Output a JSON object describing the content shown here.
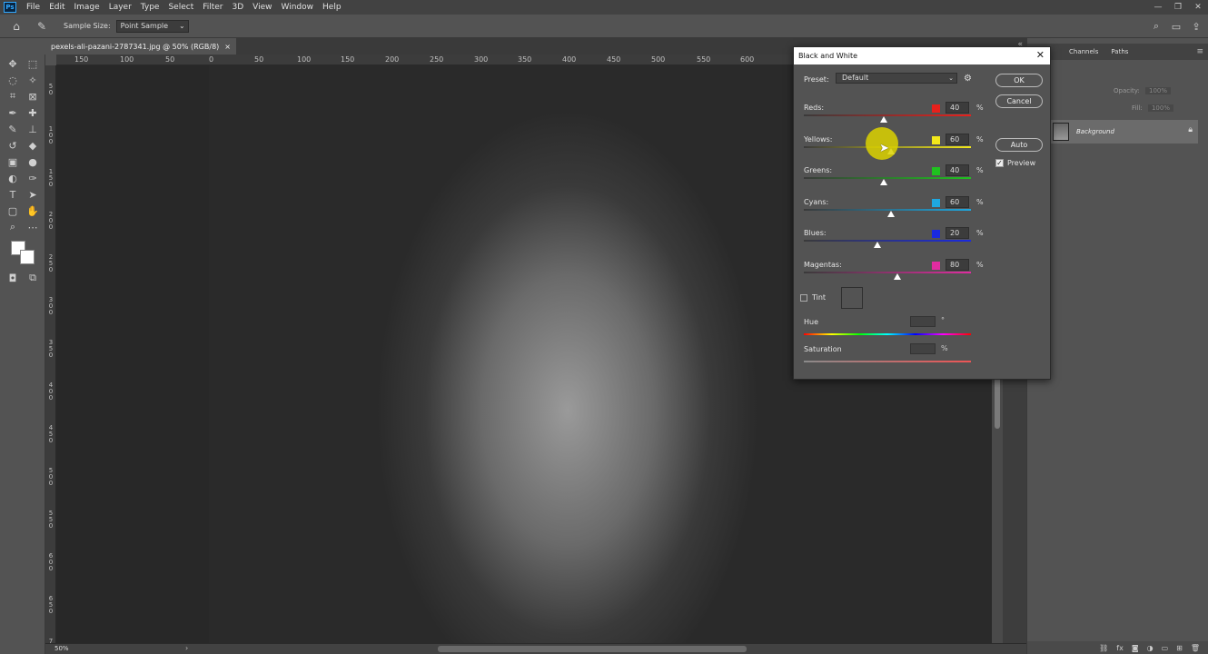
{
  "menubar": {
    "logo": "Ps",
    "items": [
      "File",
      "Edit",
      "Image",
      "Layer",
      "Type",
      "Select",
      "Filter",
      "3D",
      "View",
      "Window",
      "Help"
    ],
    "window_controls": [
      "—",
      "❐",
      "✕"
    ]
  },
  "options": {
    "sample_size_label": "Sample Size:",
    "sample_size_value": "Point Sample"
  },
  "document_tab": {
    "title": "pexels-ali-pazani-2787341.jpg @ 50% (RGB/8)",
    "close": "×"
  },
  "ruler": {
    "horizontal_labels": [
      "150",
      "100",
      "50",
      "0",
      "50",
      "100",
      "150",
      "200",
      "250",
      "300",
      "350",
      "400",
      "450",
      "500",
      "550",
      "600"
    ],
    "vertical_labels": [
      "5\n0",
      "1\n0\n0",
      "1\n5\n0",
      "2\n0\n0",
      "2\n5\n0",
      "3\n0\n0",
      "3\n5\n0",
      "4\n0\n0",
      "4\n5\n0",
      "5\n0\n0",
      "5\n5\n0",
      "6\n0\n0",
      "6\n5\n0",
      "7"
    ]
  },
  "status": {
    "zoom": "50%"
  },
  "panel": {
    "tabs": [
      "Channels",
      "Paths"
    ],
    "opacity_label": "Opacity:",
    "opacity_value": "100%",
    "fill_label": "Fill:",
    "fill_value": "100%",
    "layer_name": "Background"
  },
  "dialog": {
    "title": "Black and White",
    "preset_label": "Preset:",
    "preset_value": "Default",
    "ok": "OK",
    "cancel": "Cancel",
    "auto": "Auto",
    "preview_label": "Preview",
    "preview_checked": true,
    "pct": "%",
    "sliders": [
      {
        "label": "Reds:",
        "value": "40",
        "color": "#e8201c",
        "track_from": "#3a3a3a",
        "track_to": "#e8201c"
      },
      {
        "label": "Yellows:",
        "value": "60",
        "color": "#f2e81a",
        "track_from": "#3a3a3a",
        "track_to": "#f2e81a"
      },
      {
        "label": "Greens:",
        "value": "40",
        "color": "#1fc21f",
        "track_from": "#3a3a3a",
        "track_to": "#1fc21f"
      },
      {
        "label": "Cyans:",
        "value": "60",
        "color": "#1ea8e0",
        "track_from": "#3a3a3a",
        "track_to": "#1ea8e0"
      },
      {
        "label": "Blues:",
        "value": "20",
        "color": "#1a2ae0",
        "track_from": "#3a3a3a",
        "track_to": "#1a2ae0"
      },
      {
        "label": "Magentas:",
        "value": "80",
        "color": "#e02ca0",
        "track_from": "#3a3a3a",
        "track_to": "#e02ca0"
      }
    ],
    "tint_label": "Tint",
    "hue_label": "Hue",
    "hue_unit": "°",
    "saturation_label": "Saturation",
    "saturation_unit": "%"
  }
}
